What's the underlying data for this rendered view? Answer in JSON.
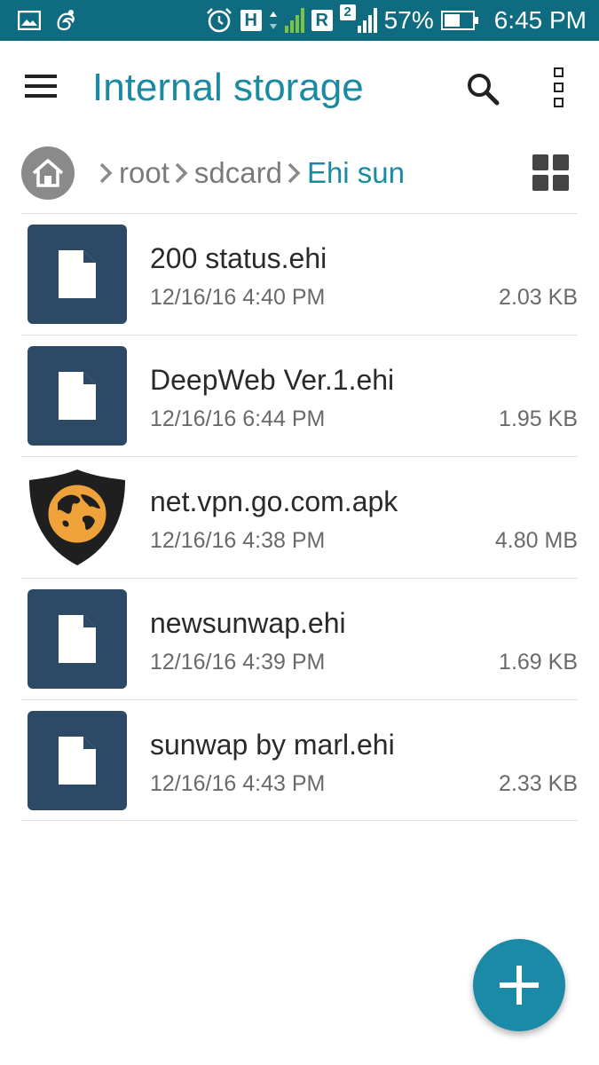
{
  "status_bar": {
    "network_type": "H",
    "sim2_indicator": "2",
    "roaming": "R",
    "battery_percent": "57%",
    "battery_level": 0.57,
    "time": "6:45 PM",
    "icons": [
      "gallery-icon",
      "uc-browser-icon",
      "alarm-icon"
    ]
  },
  "app_bar": {
    "title": "Internal storage",
    "menu_icon": "hamburger-menu-icon",
    "search_icon": "search-icon",
    "more_icon": "more-options-icon"
  },
  "breadcrumb": {
    "home_icon": "home-icon",
    "items": [
      "root",
      "sdcard",
      "Ehi sun"
    ],
    "view_toggle_icon": "grid-view-icon"
  },
  "files": [
    {
      "name": "200 status.ehi",
      "date": "12/16/16 4:40 PM",
      "size": "2.03 KB",
      "icon": "document-icon"
    },
    {
      "name": "DeepWeb Ver.1.ehi",
      "date": "12/16/16 6:44 PM",
      "size": "1.95 KB",
      "icon": "document-icon"
    },
    {
      "name": "net.vpn.go.com.apk",
      "date": "12/16/16 4:38 PM",
      "size": "4.80 MB",
      "icon": "vpn-shield-app-icon"
    },
    {
      "name": "newsunwap.ehi",
      "date": "12/16/16 4:39 PM",
      "size": "1.69 KB",
      "icon": "document-icon"
    },
    {
      "name": "sunwap by marl.ehi",
      "date": "12/16/16 4:43 PM",
      "size": "2.33 KB",
      "icon": "document-icon"
    }
  ],
  "fab": {
    "icon": "add-icon"
  },
  "colors": {
    "status_bar": "#0f6b80",
    "accent": "#1a8aa3",
    "file_thumb": "#2c4a66",
    "fab": "#1b8aa6"
  }
}
